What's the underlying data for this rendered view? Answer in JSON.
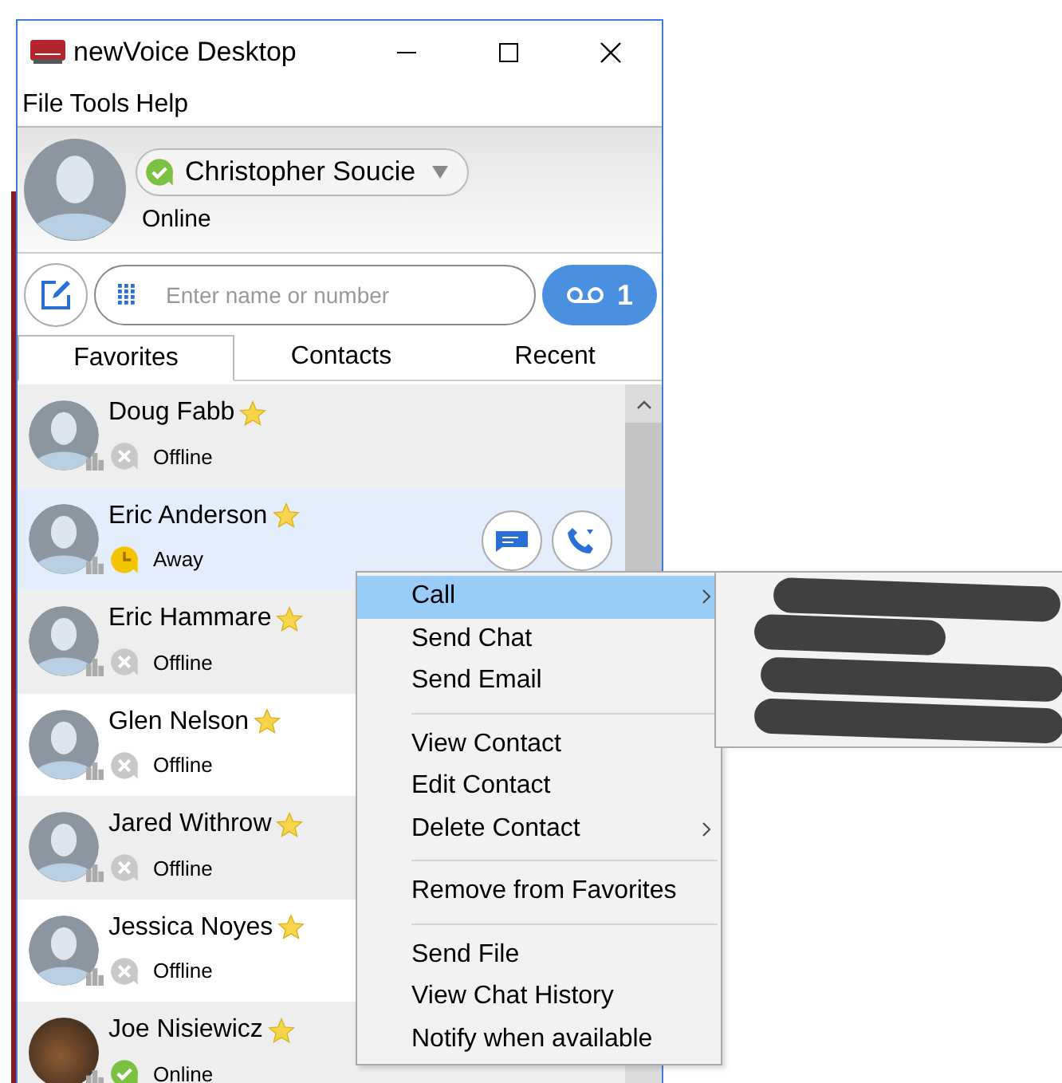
{
  "window": {
    "title": "newVoice Desktop"
  },
  "menu_bar": [
    "File",
    "Tools",
    "Help"
  ],
  "user": {
    "name": "Christopher Soucie",
    "status": "Online",
    "kind": "online"
  },
  "search": {
    "placeholder": "Enter name or number"
  },
  "voicemail": {
    "count": "1"
  },
  "tabs": [
    {
      "label": "Favorites",
      "selected": true
    },
    {
      "label": "Contacts",
      "selected": false
    },
    {
      "label": "Recent",
      "selected": false
    }
  ],
  "contacts": [
    {
      "name": "Doug Fabb",
      "status": "Offline",
      "kind": "offline",
      "photo": false,
      "selected": false
    },
    {
      "name": "Eric Anderson",
      "status": "Away",
      "kind": "away",
      "photo": false,
      "selected": true
    },
    {
      "name": "Eric Hammare",
      "status": "Offline",
      "kind": "offline",
      "photo": false,
      "selected": false
    },
    {
      "name": "Glen Nelson",
      "status": "Offline",
      "kind": "offline",
      "photo": false,
      "selected": false
    },
    {
      "name": "Jared Withrow",
      "status": "Offline",
      "kind": "offline",
      "photo": false,
      "selected": false
    },
    {
      "name": "Jessica Noyes",
      "status": "Offline",
      "kind": "offline",
      "photo": false,
      "selected": false
    },
    {
      "name": "Joe Nisiewicz",
      "status": "Online",
      "kind": "online",
      "photo": true,
      "selected": false
    }
  ],
  "context_menu": {
    "groups": [
      [
        {
          "label": "Call",
          "submenu": true,
          "selected": true
        },
        {
          "label": "Send Chat",
          "submenu": false,
          "selected": false
        },
        {
          "label": "Send Email",
          "submenu": false,
          "selected": false
        }
      ],
      [
        {
          "label": "View Contact",
          "submenu": false,
          "selected": false
        },
        {
          "label": "Edit Contact",
          "submenu": false,
          "selected": false
        },
        {
          "label": "Delete Contact",
          "submenu": true,
          "selected": false
        }
      ],
      [
        {
          "label": "Remove from Favorites",
          "submenu": false,
          "selected": false
        }
      ],
      [
        {
          "label": "Send File",
          "submenu": false,
          "selected": false
        },
        {
          "label": "View Chat History",
          "submenu": false,
          "selected": false
        },
        {
          "label": "Notify when available",
          "submenu": false,
          "selected": false
        }
      ]
    ]
  }
}
